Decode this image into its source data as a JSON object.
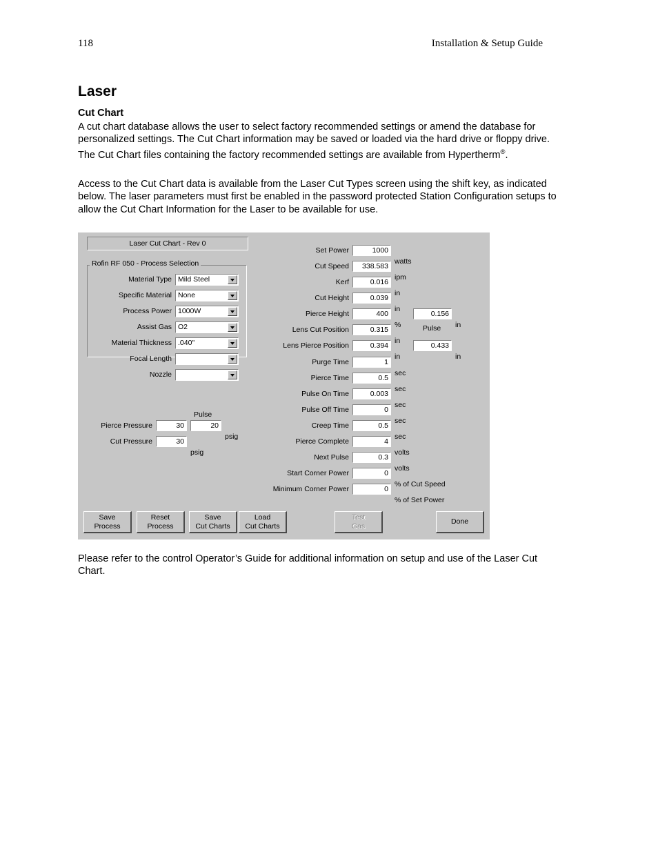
{
  "page": {
    "number": "118",
    "running_head": "Installation & Setup Guide",
    "section_title": "Laser",
    "subsection_title": "Cut Chart",
    "paragraph_1": "A cut chart database allows the user to select factory recommended settings or amend the database for personalized settings.  The Cut Chart information may be saved or loaded via the hard drive or floppy drive.  The Cut Chart files containing the factory recommended settings are available from Hypertherm",
    "paragraph_1_reg": "®",
    "paragraph_1_end": ".",
    "paragraph_2": "Access to the Cut Chart data is available from the Laser Cut Types screen using the shift key, as indicated below.  The laser parameters must first be enabled in the password protected Station Configuration setups to allow the Cut Chart Information for the Laser to be available for use.",
    "paragraph_3": "Please refer to the control Operator’s Guide for additional information on setup and use of the Laser Cut Chart."
  },
  "screen": {
    "title": "Laser Cut Chart - Rev 0",
    "process_group": {
      "legend": "Rofin RF 050 - Process Selection",
      "fields": [
        {
          "label": "Material Type",
          "value": "Mild Steel"
        },
        {
          "label": "Specific Material",
          "value": "None"
        },
        {
          "label": "Process Power",
          "value": "1000W"
        },
        {
          "label": "Assist Gas",
          "value": "O2"
        },
        {
          "label": "Material Thickness",
          "value": ".040\""
        },
        {
          "label": "Focal Length",
          "value": ""
        },
        {
          "label": "Nozzle",
          "value": ""
        }
      ]
    },
    "pressure_group": {
      "pulse_caption": "Pulse",
      "rows": [
        {
          "label": "Pierce Pressure",
          "value": "30",
          "pulse": "20",
          "unit": "psig"
        },
        {
          "label": "Cut Pressure",
          "value": "30",
          "pulse": "",
          "unit": "psig"
        }
      ]
    },
    "parameters": [
      {
        "label": "Set Power",
        "value": "1000",
        "unit": "watts",
        "extra": "",
        "extra_unit": ""
      },
      {
        "label": "Cut Speed",
        "value": "338.583",
        "unit": "ipm",
        "extra": "",
        "extra_unit": ""
      },
      {
        "label": "Kerf",
        "value": "0.016",
        "unit": "in",
        "extra": "",
        "extra_unit": ""
      },
      {
        "label": "Cut Height",
        "value": "0.039",
        "unit": "in",
        "extra": "",
        "extra_unit": ""
      },
      {
        "label": "Pierce Height",
        "value": "400",
        "unit": "%",
        "extra": "0.156",
        "extra_unit": "in"
      },
      {
        "label": "Lens Cut Position",
        "value": "0.315",
        "unit": "in",
        "extra": "",
        "extra_unit": ""
      },
      {
        "label": "Lens Pierce Position",
        "value": "0.394",
        "unit": "in",
        "extra": "0.433",
        "extra_unit": "in"
      },
      {
        "label": "Purge Time",
        "value": "1",
        "unit": "sec",
        "extra": "",
        "extra_unit": ""
      },
      {
        "label": "Pierce Time",
        "value": "0.5",
        "unit": "sec",
        "extra": "",
        "extra_unit": ""
      },
      {
        "label": "Pulse On Time",
        "value": "0.003",
        "unit": "sec",
        "extra": "",
        "extra_unit": ""
      },
      {
        "label": "Pulse Off Time",
        "value": "0",
        "unit": "sec",
        "extra": "",
        "extra_unit": ""
      },
      {
        "label": "Creep Time",
        "value": "0.5",
        "unit": "sec",
        "extra": "",
        "extra_unit": ""
      },
      {
        "label": "Pierce Complete",
        "value": "4",
        "unit": "volts",
        "extra": "",
        "extra_unit": ""
      },
      {
        "label": "Next Pulse",
        "value": "0.3",
        "unit": "volts",
        "extra": "",
        "extra_unit": ""
      },
      {
        "label": "Start Corner Power",
        "value": "0",
        "unit": "% of Cut Speed",
        "extra": "",
        "extra_unit": ""
      },
      {
        "label": "Minimum Corner Power",
        "value": "0",
        "unit": "% of Set Power",
        "extra": "",
        "extra_unit": ""
      }
    ],
    "right_pulse_caption": "Pulse",
    "buttons": [
      {
        "line1": "Save",
        "line2": "Process",
        "enabled": true
      },
      {
        "line1": "Reset",
        "line2": "Process",
        "enabled": true
      },
      {
        "line1": "Save",
        "line2": "Cut Charts",
        "enabled": true
      },
      {
        "line1": "Load",
        "line2": "Cut Charts",
        "enabled": true
      },
      {
        "line1": "Test",
        "line2": "Gas",
        "enabled": false
      },
      {
        "line1": "Done",
        "line2": "",
        "enabled": true
      }
    ],
    "colors": {
      "window_face": "#c6c6c6",
      "field_background": "#ffffff",
      "disabled_text": "#878787"
    }
  }
}
